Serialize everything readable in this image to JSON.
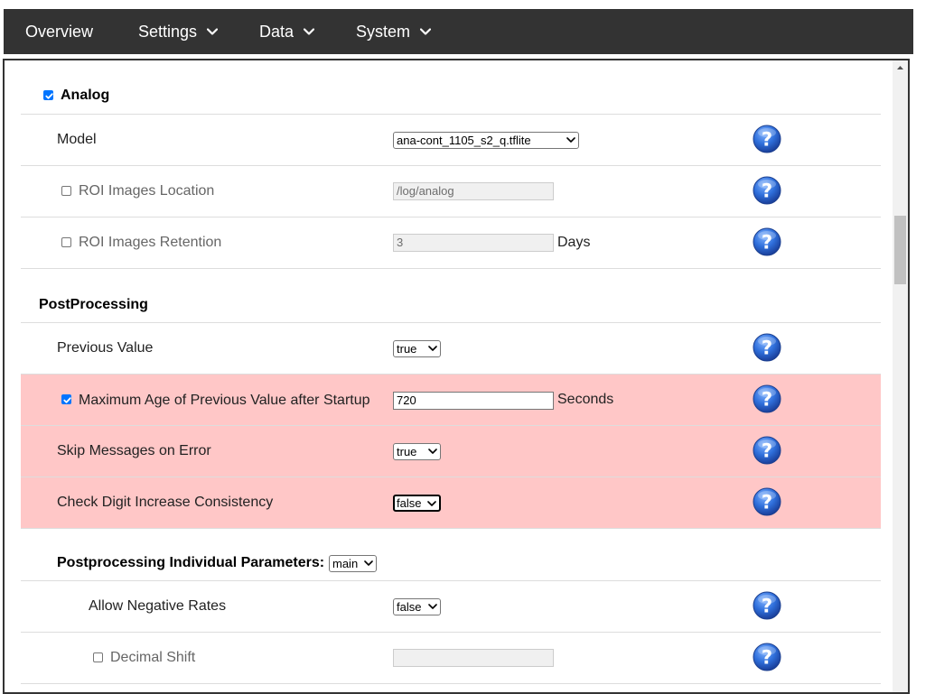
{
  "nav": {
    "overview": "Overview",
    "settings": "Settings",
    "data": "Data",
    "system": "System"
  },
  "analog": {
    "title": "Analog",
    "model_label": "Model",
    "model_value": "ana-cont_1105_s2_q.tflite",
    "roi_location_label": "ROI Images Location",
    "roi_location_value": "/log/analog",
    "roi_retention_label": "ROI Images Retention",
    "roi_retention_value": "3",
    "roi_retention_unit": "Days"
  },
  "postprocessing": {
    "title": "PostProcessing",
    "previous_value_label": "Previous Value",
    "previous_value": "true",
    "max_age_label": "Maximum Age of Previous Value after Startup",
    "max_age_value": "720",
    "max_age_unit": "Seconds",
    "skip_messages_label": "Skip Messages on Error",
    "skip_messages_value": "true",
    "check_digit_label": "Check Digit Increase Consistency",
    "check_digit_value": "false",
    "individual_label": "Postprocessing Individual Parameters:",
    "individual_value": "main",
    "allow_negative_label": "Allow Negative Rates",
    "allow_negative_value": "false",
    "decimal_shift_label": "Decimal Shift",
    "decimal_shift_value": ""
  },
  "colors": {
    "navbar": "#333333",
    "error_row": "#ffc7c7",
    "checkbox": "#0075ff",
    "help_icon": "#2a63c9"
  },
  "icons": {
    "help": "help-question-icon",
    "chevron": "chevron-down-icon"
  }
}
